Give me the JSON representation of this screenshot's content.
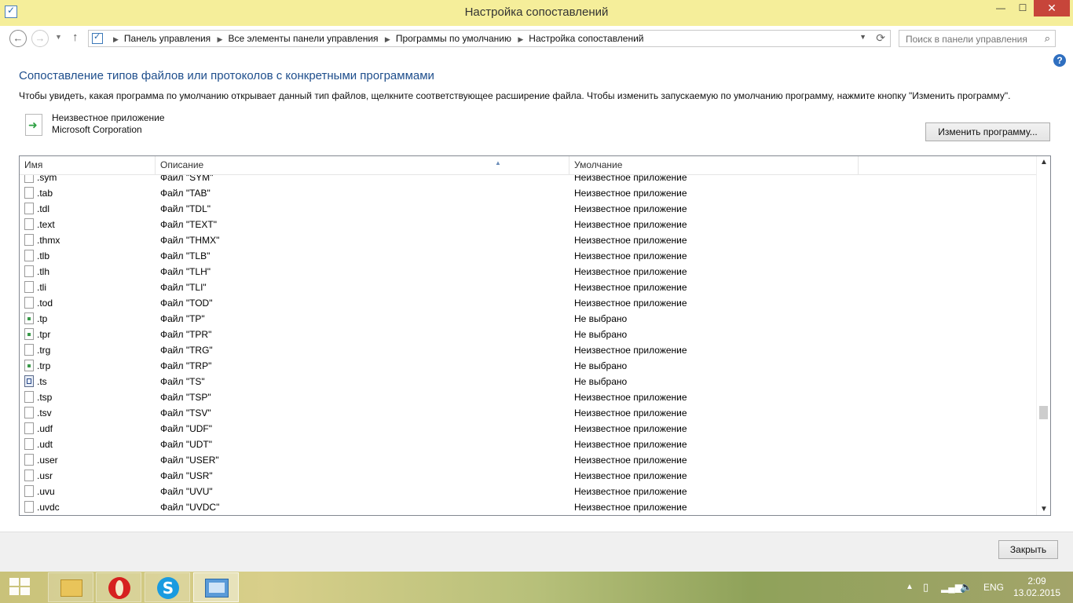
{
  "window": {
    "title": "Настройка сопоставлений",
    "minimize_label": "—",
    "maximize_label": "☐",
    "close_label": "✕"
  },
  "nav": {
    "back_glyph": "←",
    "forward_glyph": "→",
    "dropdown_glyph": "▼",
    "up_glyph": "↑",
    "breadcrumb": [
      "Панель управления",
      "Все элементы панели управления",
      "Программы по умолчанию",
      "Настройка сопоставлений"
    ],
    "separator": "▶",
    "refresh_glyph": "⟳",
    "search_placeholder": "Поиск в панели управления",
    "search_glyph": "⌕"
  },
  "main": {
    "help_glyph": "?",
    "heading": "Сопоставление типов файлов или протоколов с конкретными программами",
    "description": "Чтобы увидеть, какая программа по умолчанию открывает данный тип файлов, щелкните соответствующее расширение файла. Чтобы изменить запускаемую по умолчанию программу, нажмите кнопку \"Изменить программу\".",
    "program_name": "Неизвестное приложение",
    "program_vendor": "Microsoft Corporation",
    "change_button": "Изменить программу..."
  },
  "list": {
    "columns": [
      "Имя",
      "Описание",
      "Умолчание"
    ],
    "sort_glyph": "▲",
    "scroll_up_glyph": "▲",
    "scroll_down_glyph": "▼",
    "scroll_position": 0.74,
    "rows": [
      {
        "ext": ".sym",
        "desc": "Файл \"SYM\"",
        "default": "Неизвестное приложение",
        "icon": "file-icon"
      },
      {
        "ext": ".tab",
        "desc": "Файл \"TAB\"",
        "default": "Неизвестное приложение",
        "icon": "file-icon"
      },
      {
        "ext": ".tdl",
        "desc": "Файл \"TDL\"",
        "default": "Неизвестное приложение",
        "icon": "file-icon"
      },
      {
        "ext": ".text",
        "desc": "Файл \"TEXT\"",
        "default": "Неизвестное приложение",
        "icon": "file-icon"
      },
      {
        "ext": ".thmx",
        "desc": "Файл \"THMX\"",
        "default": "Неизвестное приложение",
        "icon": "file-icon"
      },
      {
        "ext": ".tlb",
        "desc": "Файл \"TLB\"",
        "default": "Неизвестное приложение",
        "icon": "file-icon"
      },
      {
        "ext": ".tlh",
        "desc": "Файл \"TLH\"",
        "default": "Неизвестное приложение",
        "icon": "file-icon"
      },
      {
        "ext": ".tli",
        "desc": "Файл \"TLI\"",
        "default": "Неизвестное приложение",
        "icon": "file-icon"
      },
      {
        "ext": ".tod",
        "desc": "Файл \"TOD\"",
        "default": "Неизвестное приложение",
        "icon": "file-icon"
      },
      {
        "ext": ".tp",
        "desc": "Файл \"TP\"",
        "default": "Не выбрано",
        "icon": "special-file-icon"
      },
      {
        "ext": ".tpr",
        "desc": "Файл \"TPR\"",
        "default": "Не выбрано",
        "icon": "special-file-icon"
      },
      {
        "ext": ".trg",
        "desc": "Файл \"TRG\"",
        "default": "Неизвестное приложение",
        "icon": "file-icon"
      },
      {
        "ext": ".trp",
        "desc": "Файл \"TRP\"",
        "default": "Не выбрано",
        "icon": "special-file-icon"
      },
      {
        "ext": ".ts",
        "desc": "Файл \"TS\"",
        "default": "Не выбрано",
        "icon": "ts-file-icon"
      },
      {
        "ext": ".tsp",
        "desc": "Файл \"TSP\"",
        "default": "Неизвестное приложение",
        "icon": "file-icon"
      },
      {
        "ext": ".tsv",
        "desc": "Файл \"TSV\"",
        "default": "Неизвестное приложение",
        "icon": "file-icon"
      },
      {
        "ext": ".udf",
        "desc": "Файл \"UDF\"",
        "default": "Неизвестное приложение",
        "icon": "file-icon"
      },
      {
        "ext": ".udt",
        "desc": "Файл \"UDT\"",
        "default": "Неизвестное приложение",
        "icon": "file-icon"
      },
      {
        "ext": ".user",
        "desc": "Файл \"USER\"",
        "default": "Неизвестное приложение",
        "icon": "file-icon"
      },
      {
        "ext": ".usr",
        "desc": "Файл \"USR\"",
        "default": "Неизвестное приложение",
        "icon": "file-icon"
      },
      {
        "ext": ".uvu",
        "desc": "Файл \"UVU\"",
        "default": "Неизвестное приложение",
        "icon": "file-icon"
      },
      {
        "ext": ".uvdc",
        "desc": "Файл \"UVDC\"",
        "default": "Неизвестное приложение",
        "icon": "file-icon"
      }
    ]
  },
  "footer": {
    "close_button": "Закрыть"
  },
  "taskbar": {
    "skype_glyph": "S",
    "tray_up_glyph": "▲",
    "battery_glyph": "▯",
    "network_glyph": "▂▄▆",
    "volume_glyph": "🔈",
    "language": "ENG",
    "time": "2:09",
    "date": "13.02.2015"
  },
  "colors": {
    "title_bar": "#f5ee9a",
    "heading": "#1e4e8c",
    "close_red": "#c7453a"
  }
}
